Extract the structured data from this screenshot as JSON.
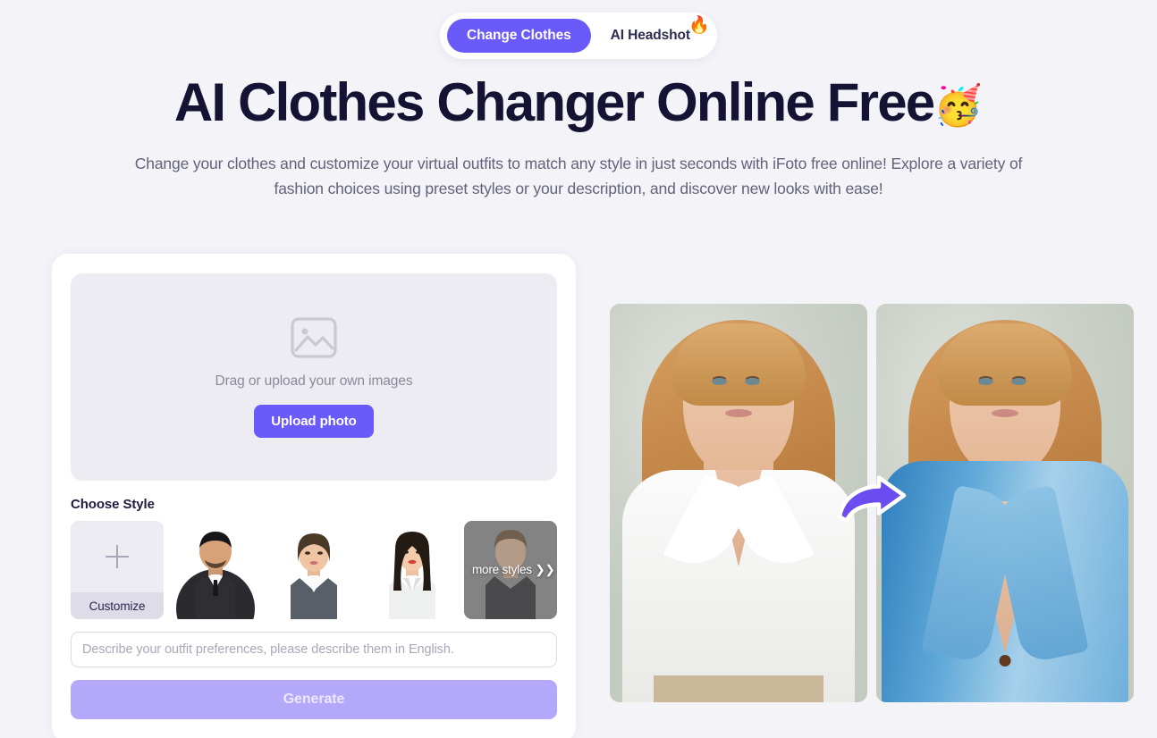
{
  "tabs": {
    "items": [
      {
        "label": "Change Clothes",
        "active": true,
        "emoji": ""
      },
      {
        "label": "AI Headshot",
        "active": false,
        "emoji": "🔥"
      }
    ]
  },
  "hero": {
    "title": "AI Clothes Changer Online Free",
    "title_emoji": "🥳",
    "subtitle": "Change your clothes and customize your virtual outfits to match any style in just seconds with iFoto free online! Explore a variety of fashion choices using preset styles or your description, and discover new looks with ease!"
  },
  "uploader": {
    "icon": "image-placeholder-icon",
    "hint": "Drag or upload your own images",
    "button_label": "Upload photo"
  },
  "styles": {
    "label": "Choose Style",
    "items": [
      {
        "name": "customize",
        "label": "Customize",
        "icon": "plus-icon"
      },
      {
        "name": "style-man-black-suit",
        "label": ""
      },
      {
        "name": "style-woman-grey-suit",
        "label": ""
      },
      {
        "name": "style-woman-white-shirt",
        "label": ""
      },
      {
        "name": "style-more",
        "label": "more styles ❯❯"
      }
    ]
  },
  "prompt": {
    "value": "",
    "placeholder": "Describe your outfit preferences, please describe them in English."
  },
  "generate": {
    "label": "Generate",
    "enabled": false
  },
  "preview": {
    "before_alt": "Woman in white button-down shirt",
    "after_alt": "Woman in light blue blazer",
    "arrow": "curved-right-arrow-icon"
  },
  "colors": {
    "accent": "#6a5af9",
    "accent_disabled": "#b3a8fa",
    "page_bg": "#f4f3f8",
    "card_bg": "#ffffff",
    "dropzone_bg": "#edecf2",
    "title": "#141334",
    "muted_text": "#62627a"
  }
}
